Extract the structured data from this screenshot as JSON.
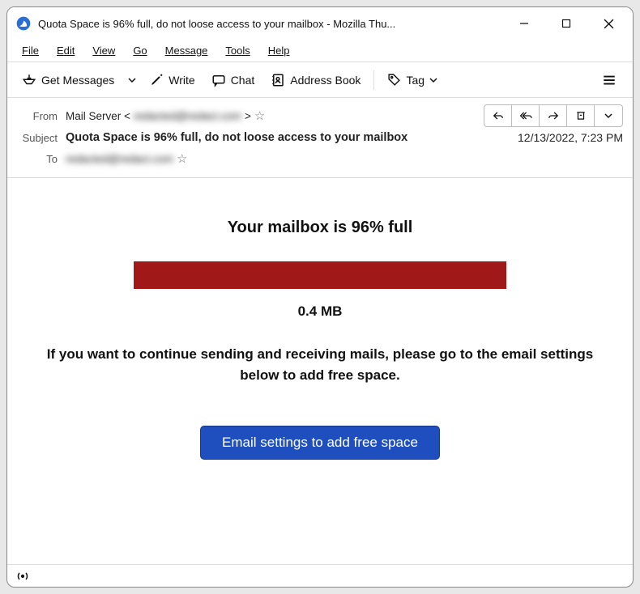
{
  "window": {
    "title": "Quota Space is 96% full, do not loose access to your mailbox - Mozilla Thu..."
  },
  "menu": {
    "file": "File",
    "edit": "Edit",
    "view": "View",
    "go": "Go",
    "message": "Message",
    "tools": "Tools",
    "help": "Help"
  },
  "toolbar": {
    "get_messages": "Get Messages",
    "write": "Write",
    "chat": "Chat",
    "address_book": "Address Book",
    "tag": "Tag"
  },
  "headers": {
    "from_label": "From",
    "from_value": "Mail Server <",
    "from_suffix": ">",
    "subject_label": "Subject",
    "subject_value": "Quota Space is 96% full, do not loose access to your mailbox",
    "to_label": "To",
    "date": "12/13/2022, 7:23 PM"
  },
  "body": {
    "heading": "Your mailbox is 96% full",
    "size": "0.4 MB",
    "message": "If you want to continue sending and receiving mails, please go to the email settings below to add free space.",
    "cta": "Email settings to add free space"
  }
}
